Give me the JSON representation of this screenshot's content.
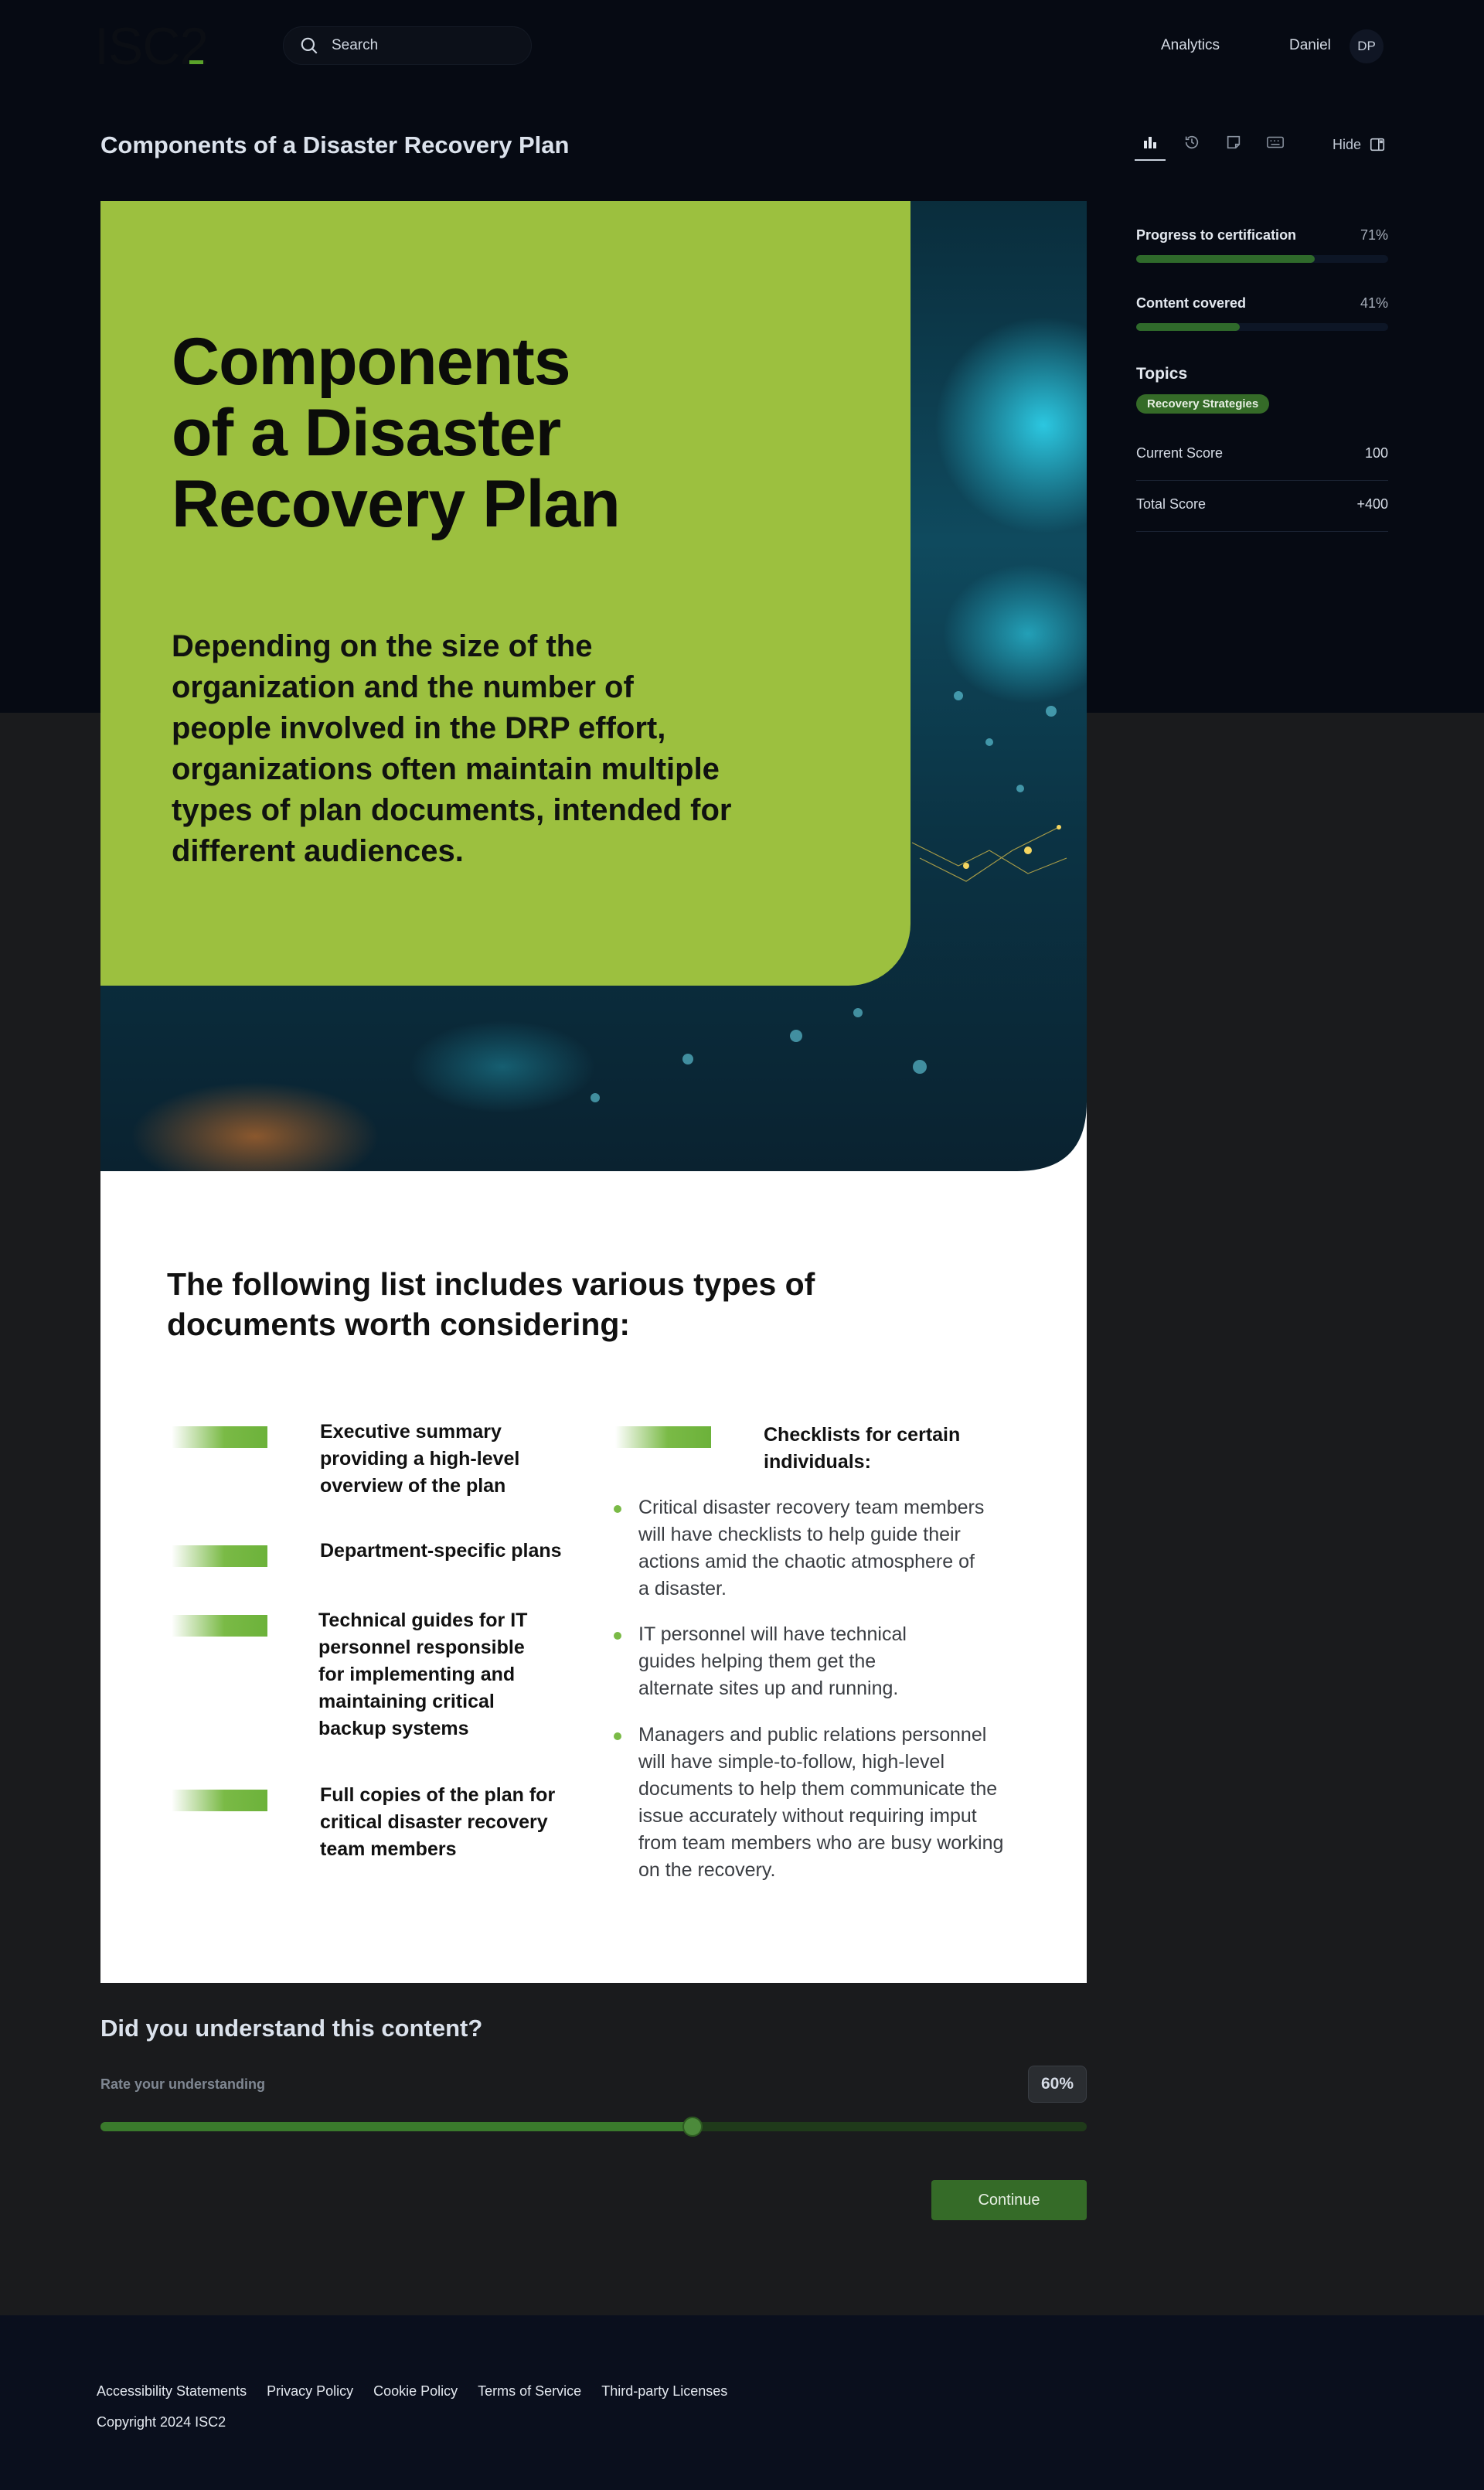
{
  "header": {
    "logo": "ISC2",
    "search_placeholder": "Search",
    "nav_analytics": "Analytics",
    "user_name": "Daniel",
    "user_initials": "DP"
  },
  "page": {
    "title": "Components of a Disaster Recovery Plan",
    "hide_label": "Hide"
  },
  "hero": {
    "title_lines": [
      "Components",
      "of a Disaster",
      "Recovery Plan"
    ],
    "description": "Depending on the size of the organization and the number of people involved in the DRP effort, organizations often maintain multiple types of plan documents, intended for different audiences."
  },
  "content": {
    "heading": "The following list includes various types of documents worth considering:",
    "documents": [
      "Executive summary providing a high-level overview of the plan",
      "Department-specific plans",
      "Technical guides for IT personnel responsible for implementing and maintaining critical backup systems",
      "Full copies of the plan for critical disaster recovery team members"
    ],
    "checklists_title": "Checklists for certain individuals:",
    "bullets": [
      "Critical disaster recovery team members will have checklists to help guide their actions amid the chaotic atmosphere of a disaster.",
      "IT personnel will have technical guides helping them get the alternate sites up and running.",
      "Managers and public relations personnel will have simple-to-follow, high-level documents to help them communicate the issue accurately without requiring imput from team members who are busy working on the recovery."
    ]
  },
  "understanding": {
    "title": "Did you understand this content?",
    "rate_label": "Rate your understanding",
    "value_text": "60%",
    "value": 0.6,
    "continue_label": "Continue"
  },
  "sidebar": {
    "progress_label": "Progress to certification",
    "progress_value": "71%",
    "progress_fraction": 0.71,
    "content_label": "Content covered",
    "content_value": "41%",
    "content_fraction": 0.41,
    "topics_label": "Topics",
    "topic_chip": "Recovery Strategies",
    "current_score_label": "Current Score",
    "current_score_value": "100",
    "total_score_label": "Total Score",
    "total_score_value": "+400"
  },
  "footer": {
    "links": [
      "Accessibility Statements",
      "Privacy Policy",
      "Cookie Policy",
      "Terms of Service",
      "Third-party Licenses"
    ],
    "copyright": "Copyright 2024 ISC2"
  },
  "colors": {
    "accent_green": "#9cc03f",
    "button_green": "#356b28",
    "background_dark": "#060a13"
  },
  "icons": [
    "search-icon",
    "analytics-icon",
    "history-icon",
    "notes-icon",
    "keyboard-icon",
    "hide-panel-icon"
  ]
}
